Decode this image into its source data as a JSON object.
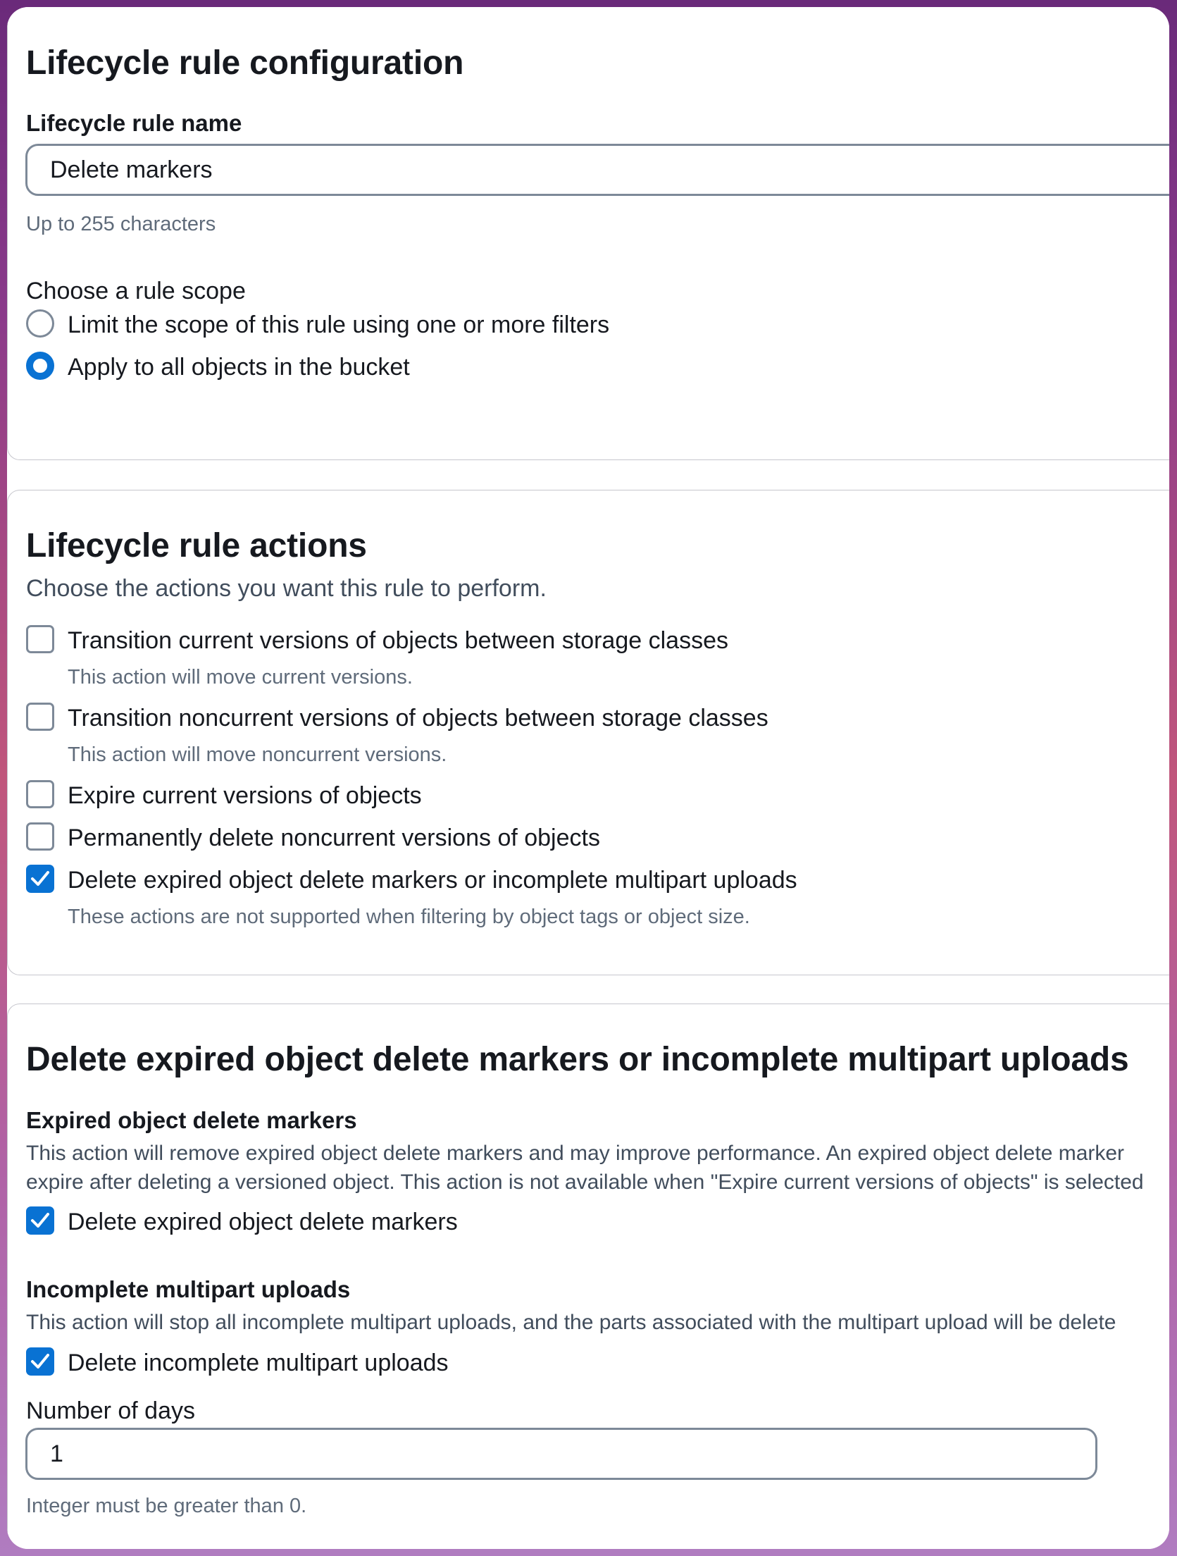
{
  "config": {
    "heading": "Lifecycle rule configuration",
    "name_label": "Lifecycle rule name",
    "name_value": "Delete markers",
    "name_hint": "Up to 255 characters",
    "scope_label": "Choose a rule scope",
    "scope_options": [
      {
        "label": "Limit the scope of this rule using one or more filters",
        "selected": false
      },
      {
        "label": "Apply to all objects in the bucket",
        "selected": true
      }
    ]
  },
  "actions": {
    "heading": "Lifecycle rule actions",
    "description": "Choose the actions you want this rule to perform.",
    "items": [
      {
        "label": "Transition current versions of objects between storage classes",
        "hint": "This action will move current versions.",
        "checked": false
      },
      {
        "label": "Transition noncurrent versions of objects between storage classes",
        "hint": "This action will move noncurrent versions.",
        "checked": false
      },
      {
        "label": "Expire current versions of objects",
        "hint": "",
        "checked": false
      },
      {
        "label": "Permanently delete noncurrent versions of objects",
        "hint": "",
        "checked": false
      },
      {
        "label": "Delete expired object delete markers or incomplete multipart uploads",
        "hint": "These actions are not supported when filtering by object tags or object size.",
        "checked": true
      }
    ]
  },
  "delete_section": {
    "heading": "Delete expired object delete markers or incomplete multipart uploads",
    "expired_label": "Expired object delete markers",
    "expired_desc_line1": "This action will remove expired object delete markers and may improve performance. An expired object delete marker",
    "expired_desc_line2": "expire after deleting a versioned object. This action is not available when \"Expire current versions of objects\" is selected",
    "expired_checkbox": {
      "label": "Delete expired object delete markers",
      "checked": true
    },
    "multipart_label": "Incomplete multipart uploads",
    "multipart_desc": "This action will stop all incomplete multipart uploads, and the parts associated with the multipart upload will be delete",
    "multipart_checkbox": {
      "label": "Delete incomplete multipart uploads",
      "checked": true
    },
    "days_label": "Number of days",
    "days_value": "1",
    "days_hint": "Integer must be greater than 0."
  },
  "colors": {
    "accent": "#0972d3",
    "border": "#7d8998",
    "hint": "#5f6b7a"
  }
}
